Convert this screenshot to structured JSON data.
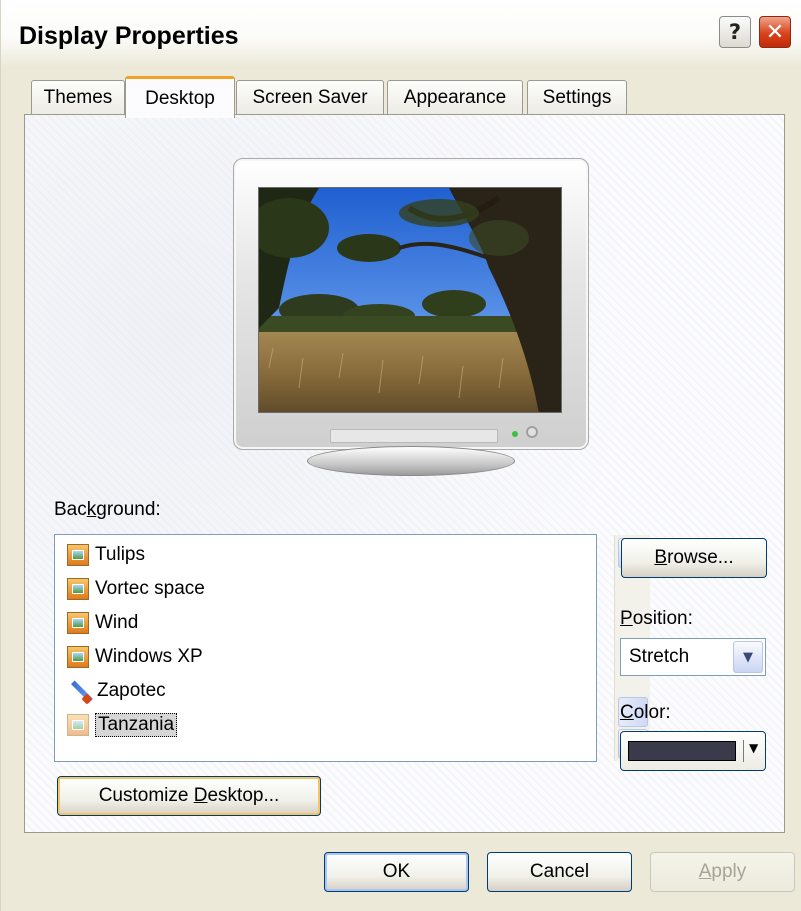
{
  "window": {
    "title": "Display Properties",
    "help_label": "?",
    "close_label": "✕"
  },
  "tabs": [
    {
      "label": "Themes",
      "active": false
    },
    {
      "label": "Desktop",
      "active": true
    },
    {
      "label": "Screen Saver",
      "active": false
    },
    {
      "label": "Appearance",
      "active": false
    },
    {
      "label": "Settings",
      "active": false
    }
  ],
  "desktop": {
    "background_label_pre": "Bac",
    "background_label_key": "k",
    "background_label_post": "ground:",
    "background_items": [
      {
        "label": "Tulips",
        "icon": "image-file-icon"
      },
      {
        "label": "Vortec space",
        "icon": "image-file-icon"
      },
      {
        "label": "Wind",
        "icon": "image-file-icon"
      },
      {
        "label": "Windows XP",
        "icon": "image-file-icon"
      },
      {
        "label": "Zapotec",
        "icon": "paint-brush-icon"
      },
      {
        "label": "Tanzania",
        "icon": "image-file-icon",
        "selected": true
      }
    ],
    "browse_key": "B",
    "browse_rest": "rowse...",
    "position_key": "P",
    "position_rest": "osition:",
    "position_value": "Stretch",
    "color_key": "C",
    "color_rest": "olor:",
    "color_value": "#3b3a4a",
    "customize_pre": "Customize ",
    "customize_key": "D",
    "customize_post": "esktop..."
  },
  "buttons": {
    "ok": "OK",
    "cancel": "Cancel",
    "apply_key": "A",
    "apply_rest": "pply"
  },
  "colors": {
    "tab_highlight": "#f4a226",
    "close_red": "#d8431c",
    "focus_border": "#003c74"
  }
}
